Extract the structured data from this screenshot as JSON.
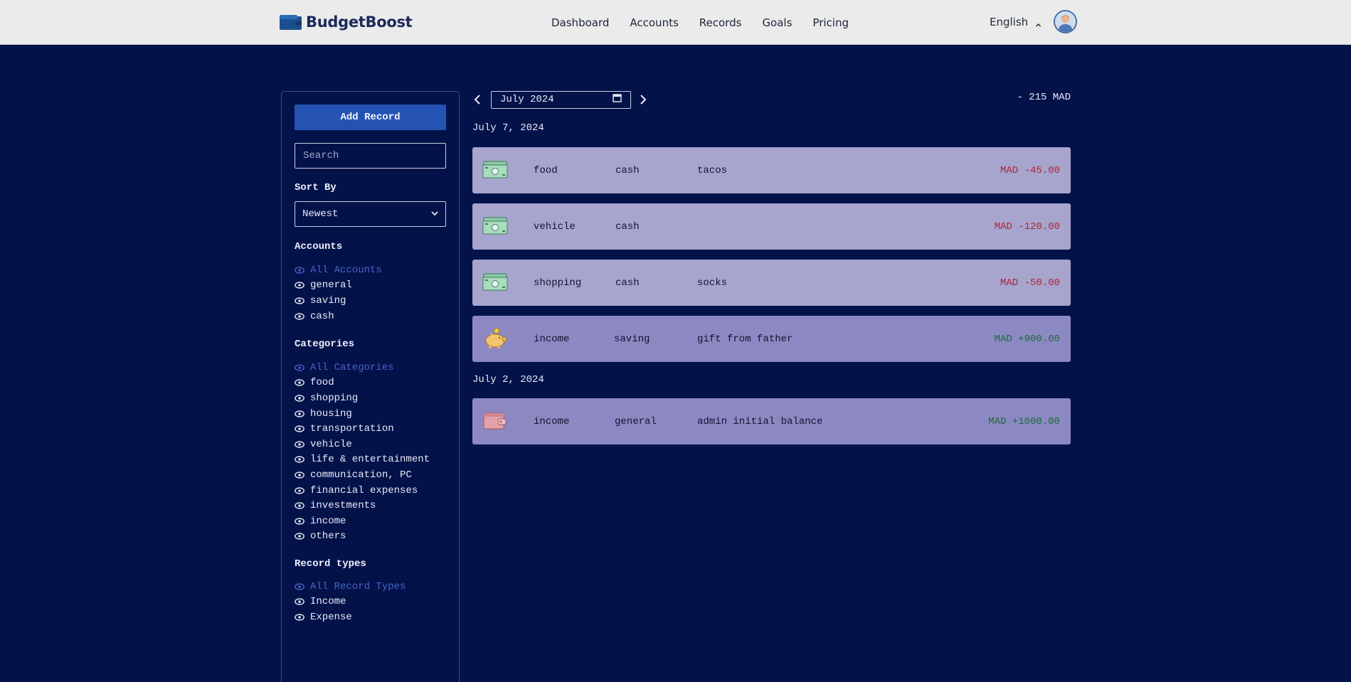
{
  "brand": {
    "name": "BudgetBoost"
  },
  "nav": {
    "links": [
      "Dashboard",
      "Accounts",
      "Records",
      "Goals",
      "Pricing"
    ],
    "language": "English"
  },
  "sidebar": {
    "add_button": "Add Record",
    "search_placeholder": "Search",
    "sort_title": "Sort By",
    "sort_value": "Newest",
    "accounts_title": "Accounts",
    "accounts": [
      "All Accounts",
      "general",
      "saving",
      "cash"
    ],
    "categories_title": "Categories",
    "categories": [
      "All Categories",
      "food",
      "shopping",
      "housing",
      "transportation",
      "vehicle",
      "life & entertainment",
      "communication, PC",
      "financial expenses",
      "investments",
      "income",
      "others"
    ],
    "record_types_title": "Record types",
    "record_types": [
      "All Record Types",
      "Income",
      "Expense"
    ]
  },
  "main": {
    "month": "July 2024",
    "total": "- 215 MAD",
    "groups": [
      {
        "date": "July 7, 2024",
        "records": [
          {
            "icon": "cash-icon",
            "category": "food",
            "account": "cash",
            "note": "tacos",
            "amount": "MAD -45.00",
            "type": "expense"
          },
          {
            "icon": "cash-icon",
            "category": "vehicle",
            "account": "cash",
            "note": "",
            "amount": "MAD -120.00",
            "type": "expense"
          },
          {
            "icon": "cash-icon",
            "category": "shopping",
            "account": "cash",
            "note": "socks",
            "amount": "MAD -50.00",
            "type": "expense"
          },
          {
            "icon": "piggy-bank-icon",
            "category": "income",
            "account": "saving",
            "note": "gift from father",
            "amount": "MAD +900.00",
            "type": "income"
          }
        ]
      },
      {
        "date": "July 2, 2024",
        "records": [
          {
            "icon": "wallet-icon",
            "category": "income",
            "account": "general",
            "note": "admin initial balance",
            "amount": "MAD +1000.00",
            "type": "income"
          }
        ]
      }
    ]
  },
  "colors": {
    "background": "#04124a",
    "accent": "#2453b3",
    "expense_row": "#a7a5ce",
    "income_row": "#8c89c2",
    "negative": "#b0262f",
    "positive": "#1c6b3a"
  }
}
